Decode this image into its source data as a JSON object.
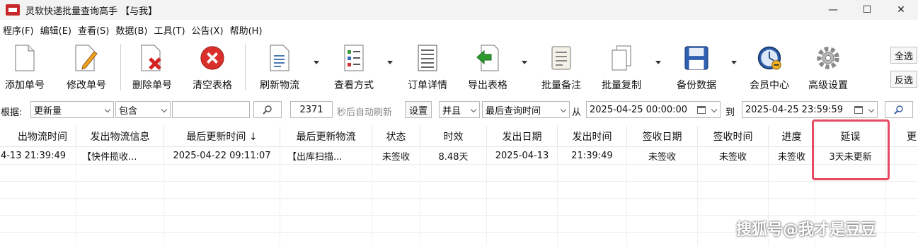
{
  "window": {
    "title": "灵软快递批量查询高手 【与我】",
    "controls": [
      "—",
      "☐",
      "✕"
    ]
  },
  "menu": [
    "程序(F)",
    "编辑(E)",
    "查看(S)",
    "数据(B)",
    "工具(T)",
    "公告(X)",
    "帮助(H)"
  ],
  "toolbar": {
    "add": "添加单号",
    "edit": "修改单号",
    "delete": "删除单号",
    "clear": "清空表格",
    "refresh": "刷新物流",
    "view_mode": "查看方式",
    "order_detail": "订单详情",
    "export": "导出表格",
    "batch_note": "批量备注",
    "batch_copy": "批量复制",
    "backup": "备份数据",
    "member": "会员中心",
    "advanced": "高级设置",
    "select_all": "全选",
    "invert": "反选"
  },
  "filter": {
    "by_label": "根据:",
    "field": "更新量",
    "op": "包含",
    "keyword": "",
    "refresh_seconds": "2371",
    "auto_refresh_label": "秒后自动刷新",
    "settings": "设置",
    "logic": "并且",
    "time_field": "最后查询时间",
    "from_label": "从",
    "from": "2025-04-25 00:00:00",
    "to_label": "到",
    "to": "2025-04-25 23:59:59"
  },
  "table": {
    "headers": [
      "出物流时间",
      "发出物流信息",
      "最后更新时间 ↓",
      "最后更新物流",
      "状态",
      "时效",
      "发出日期",
      "发出时间",
      "签收日期",
      "签收时间",
      "进度",
      "延误",
      "更"
    ],
    "rows": [
      [
        "4-13 21:39:49",
        "【快件揽收...",
        "2025-04-22 09:11:07",
        "【出库扫描...",
        "未签收",
        "8.48天",
        "2025-04-13",
        "21:39:49",
        "未签收",
        "未签收",
        "未签收",
        "3天未更新",
        ""
      ]
    ]
  },
  "watermark": "搜狐号@我才是豆豆",
  "colors": {
    "highlight": "#e84a63"
  }
}
